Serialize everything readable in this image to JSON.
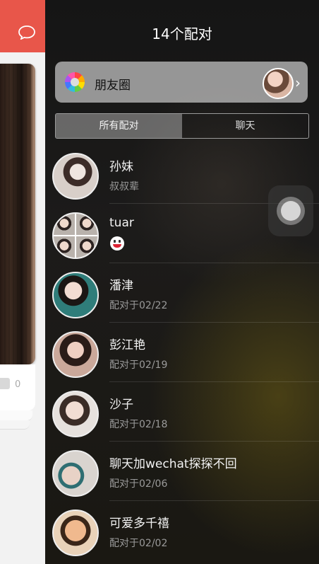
{
  "background_app": {
    "like_count": "0",
    "header_color": "#e8564a"
  },
  "panel": {
    "title": "14个配对",
    "moments": {
      "label": "朋友圈",
      "icon": "color-wheel-icon"
    },
    "tabs": [
      {
        "label": "所有配对",
        "active": true
      },
      {
        "label": "聊天",
        "active": false
      }
    ],
    "matches": [
      {
        "name": "孙妹",
        "subtitle": "叔叔辈"
      },
      {
        "name": "tuar",
        "subtitle": "",
        "message_icon": "grinning-emoji-icon"
      },
      {
        "name": "潘津",
        "subtitle": "配对于02/22"
      },
      {
        "name": "彭江艳",
        "subtitle": "配对于02/19"
      },
      {
        "name": "沙子",
        "subtitle": "配对于02/18"
      },
      {
        "name": "聊天加wechat探探不回",
        "subtitle": "配对于02/06"
      },
      {
        "name": "可爱多千禧",
        "subtitle": "配对于02/02"
      }
    ]
  }
}
